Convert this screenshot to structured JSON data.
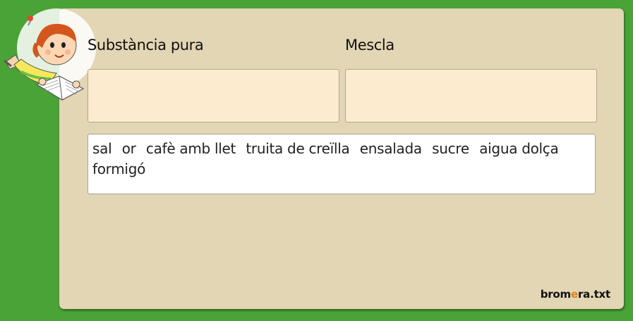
{
  "categories": {
    "pure": {
      "label": "Substància pura"
    },
    "mixture": {
      "label": "Mescla"
    }
  },
  "word_bank": {
    "words": [
      "sal",
      "or",
      "cafè amb llet",
      "truita de creïlla",
      "ensalada",
      "sucre",
      "aigua dolça",
      "formigó"
    ]
  },
  "brand": {
    "prefix": "brom",
    "accent": "e",
    "suffix": "ra.txt"
  },
  "colors": {
    "background": "#4aa336",
    "panel": "#e2d6b4",
    "dropbox": "#fdebd0",
    "accent": "#e0801c"
  },
  "icons": {
    "mascot": "astronaut-reader-icon"
  }
}
